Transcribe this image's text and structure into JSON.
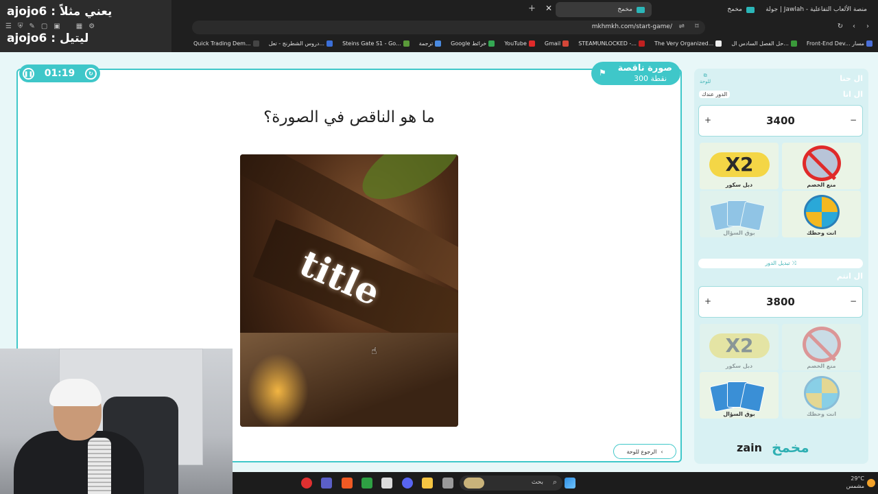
{
  "overlay": {
    "line1": "ajojo6 : يعني مثلاً",
    "line2": "ajojo6 : ليتيل"
  },
  "browser": {
    "tabs": [
      {
        "label": "مخمخ"
      },
      {
        "label": "مخمخ"
      },
      {
        "label": "جولة | Jawlah - منصة الألعاب التفاعلية"
      }
    ],
    "url": "mkhmkh.com/start-game/",
    "bookmarks": [
      {
        "label": "Quick Trading Dem...",
        "color": "#444"
      },
      {
        "label": "دروس الشطرنج - تعل...",
        "color": "#3b6fd8"
      },
      {
        "label": "Steins Gate S1 - Go...",
        "color": "#5a9a3a"
      },
      {
        "label": "ترجمة",
        "color": "#4a8ae0"
      },
      {
        "label": "Google خرائط",
        "color": "#34a853"
      },
      {
        "label": "YouTube",
        "color": "#e02a2a"
      },
      {
        "label": "Gmail",
        "color": "#d44638"
      },
      {
        "label": "STEAMUNLOCKED -...",
        "color": "#c02020"
      },
      {
        "label": "The Very Organized...",
        "color": "#eeeeee"
      },
      {
        "label": "حل الفصل السادس ال...",
        "color": "#3a9a3a"
      },
      {
        "label": "Front-End Dev... مسار",
        "color": "#4a6fd8"
      }
    ]
  },
  "game": {
    "timer": "01:19",
    "category": "صورة ناقصة",
    "points": "300 نقطة",
    "question": "ما هو الناقص في الصورة؟",
    "image_text": "title",
    "back_label": "الرجوع للوحة"
  },
  "side": {
    "board_link": "للوحة",
    "team1": {
      "name": "ال حنا",
      "sub": "ال انا",
      "turn_badge": "الدور عندك",
      "score": "3400"
    },
    "team2": {
      "name": "ال انتم",
      "score": "3800"
    },
    "tools": {
      "double": "دبل سكور",
      "block": "منع الخصم",
      "cards": "بوق السؤال",
      "wheel": "انت وحظك",
      "x2_text": "X2"
    },
    "swap_label": "تبديل الدور",
    "zain": "zain",
    "brand": "مخمخ"
  },
  "taskbar": {
    "search": "بحث",
    "temp": "29°C",
    "weather": "مشمس"
  }
}
